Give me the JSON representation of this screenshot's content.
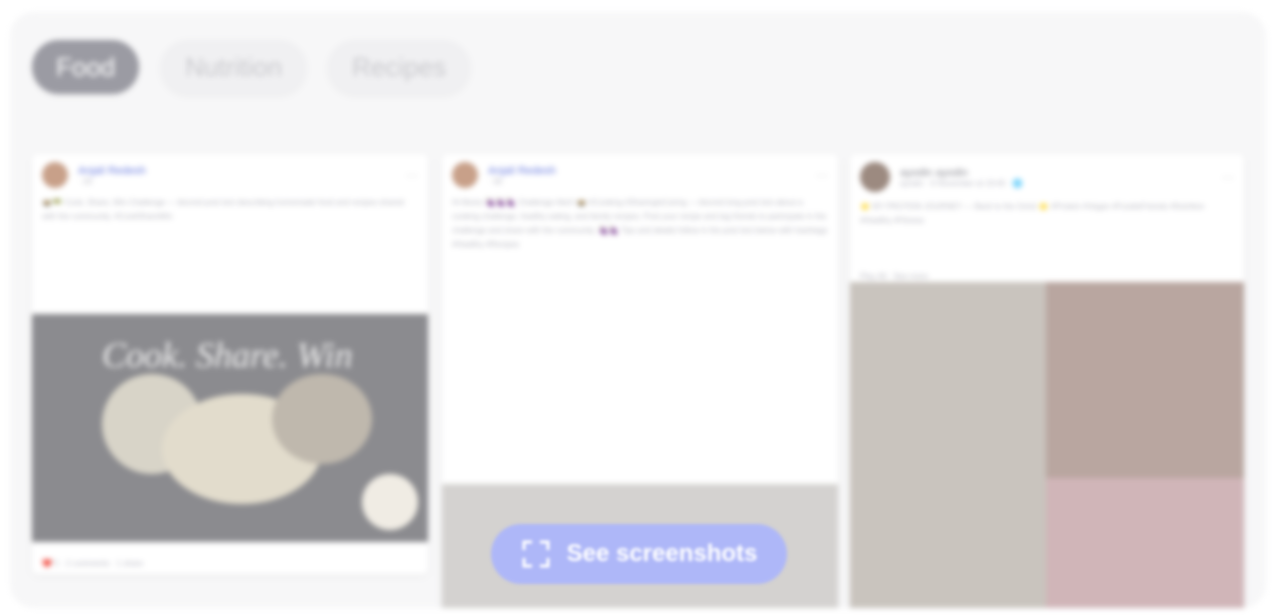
{
  "tabs": [
    {
      "label": "Food",
      "active": true
    },
    {
      "label": "Nutrition",
      "active": false
    },
    {
      "label": "Recipes",
      "active": false
    }
  ],
  "posts": [
    {
      "author": "Anjali Redesh",
      "meta": "· 2d",
      "text": "🍲🥗 Cook, Share, Win Challenge — blurred post text describing homemade food and recipes shared with the community. #CookShareWin",
      "image_caption": "Cook. Share. Win",
      "reactions": "❤️ 5 · 2 comments · 1 share"
    },
    {
      "author": "Anjali Redesh",
      "meta": "· 3d",
      "text": "Hi Mums 🍇🍇🍇 Challenge Alert! 🍲 #Cooking #SharingIsCaring — blurred long post text about a cooking challenge, healthy eating, and family recipes. Post your recipe and tag friends to participate in the challenge and share with the community. 🍇🍇 Tips and details follow in the post text below with hashtags #Healthy #Recipes",
      "reactions": ""
    },
    {
      "author": "ayodin ayodin",
      "meta": "ayodin · 6 November at 19:45 · 🌐",
      "text": "⭐ MY PROTEIN JOURNEY — Back to the Grind ⭐ #Protein #Vegan #FoodieFriends #Nutrition #Healthy #Fitness",
      "extra": "Play All · See more",
      "reactions": ""
    }
  ],
  "cta": {
    "label": "See screenshots"
  },
  "colors": {
    "accent": "#aeb7f8",
    "chip_active": "#9b9ba3"
  }
}
